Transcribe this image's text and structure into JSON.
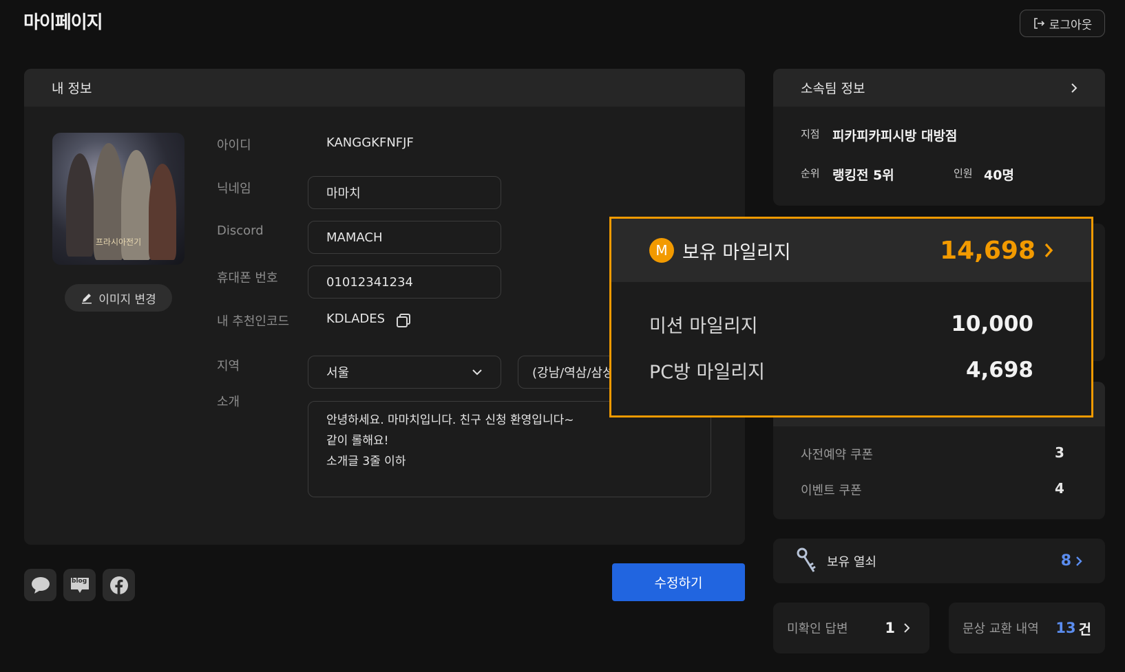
{
  "header": {
    "title": "마이페이지",
    "logout_label": "로그아웃"
  },
  "my_info": {
    "title": "내 정보",
    "avatar_logo_text": "프라시아전기",
    "image_change_label": "이미지 변경",
    "fields": {
      "id_label": "아이디",
      "id_value": "KANGGKFNFJF",
      "nickname_label": "닉네임",
      "nickname_value": "마마치",
      "discord_label": "Discord",
      "discord_value": "MAMACH",
      "phone_label": "휴대폰 번호",
      "phone_value": "01012341234",
      "referral_label": "내 추천인코드",
      "referral_value": "KDLADES",
      "region_label": "지역",
      "region_value": "서울",
      "region_sub_value": "(강남/역삼/삼성",
      "intro_label": "소개",
      "intro_lines": [
        "안녕하세요. 마마치입니다. 친구 신청 환영입니다~",
        "같이 롤해요!",
        "소개글 3줄 이하"
      ]
    },
    "edit_button": "수정하기"
  },
  "social": {
    "icons": [
      "chat-icon",
      "blog-icon",
      "facebook-icon"
    ],
    "blog_text": "blog"
  },
  "team": {
    "title": "소속팀 정보",
    "branch_label": "지점",
    "branch_value": "피카피카피시방 대방점",
    "rank_label": "순위",
    "rank_value": "랭킹전 5위",
    "members_label": "인원",
    "members_value": "40명"
  },
  "mileage": {
    "badge": "M",
    "title": "보유 마일리지",
    "total": "14,698",
    "rows": [
      {
        "label": "미션 마일리지",
        "value": "10,000"
      },
      {
        "label": "PC방 마일리지",
        "value": "4,698"
      }
    ],
    "accent_color": "#f29a00"
  },
  "coupons": {
    "rows": [
      {
        "label": "사전예약 쿠폰",
        "value": "3"
      },
      {
        "label": "이벤트 쿠폰",
        "value": "4"
      }
    ]
  },
  "keys": {
    "label": "보유 열쇠",
    "value": "8"
  },
  "unconfirmed": {
    "label": "미확인 답변",
    "value": "1"
  },
  "exchange": {
    "label": "문상 교환 내역",
    "value": "13",
    "unit": "건"
  }
}
